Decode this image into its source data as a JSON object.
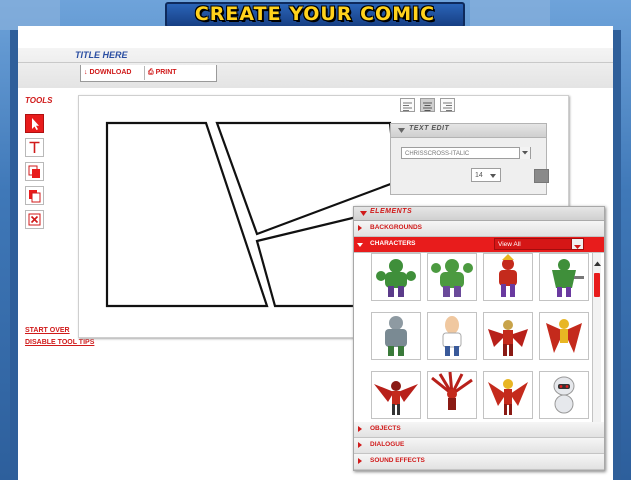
{
  "app": {
    "logo_text": "CREATE YOUR COMIC"
  },
  "header": {
    "title": "TITLE HERE"
  },
  "toolbar": {
    "download_label": "DOWNLOAD",
    "print_label": "PRINT"
  },
  "tools": {
    "label": "TOOLS",
    "items": [
      {
        "name": "select-tool",
        "icon": "arrow-cursor-icon",
        "active": true
      },
      {
        "name": "text-tool",
        "icon": "text-t-icon",
        "active": false
      },
      {
        "name": "bring-front-tool",
        "icon": "layer-front-icon",
        "active": false
      },
      {
        "name": "send-back-tool",
        "icon": "layer-back-icon",
        "active": false
      },
      {
        "name": "delete-tool",
        "icon": "delete-x-icon",
        "active": false
      }
    ]
  },
  "links": {
    "start_over": "START OVER",
    "disable_tips": "DISABLE TOOL TIPS"
  },
  "text_edit": {
    "title": "TEXT EDIT",
    "font_value": "CHRISSCROSS-ITALIC",
    "size_value": "14",
    "alignments": [
      "left",
      "center",
      "right"
    ],
    "selected_alignment": "center"
  },
  "elements": {
    "title": "ELEMENTS",
    "sections": {
      "backgrounds": "BACKGROUNDS",
      "characters": "CHARACTERS",
      "objects": "OBJECTS",
      "dialogue": "DIALOGUE",
      "sound_effects": "SOUND EFFECTS"
    },
    "filter_value": "View All"
  },
  "colors": {
    "accent": "#e81c1c",
    "logo_yellow": "#ffd21c",
    "logo_blue": "#2a64b7",
    "title_blue": "#2a4ea2"
  }
}
